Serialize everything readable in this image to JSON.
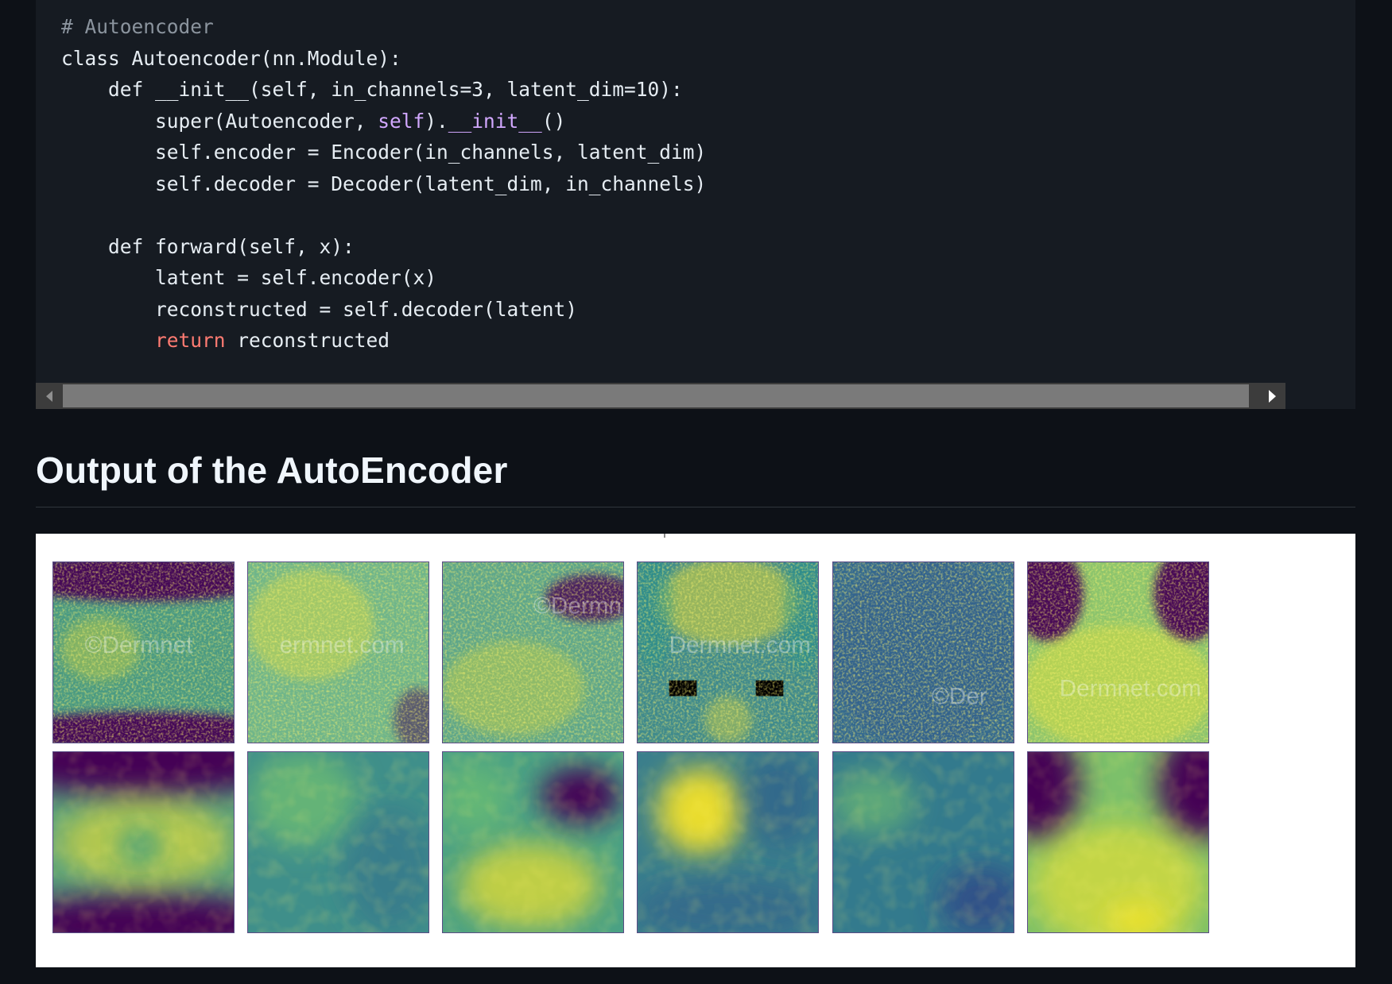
{
  "code": {
    "lines": [
      [
        {
          "t": "# Autoencoder",
          "c": "comment"
        }
      ],
      [
        {
          "t": "class Autoencoder(nn.Module):",
          "c": "plain"
        }
      ],
      [
        {
          "t": "    def __init__(self, in_channels=3, latent_dim=10):",
          "c": "plain"
        }
      ],
      [
        {
          "t": "        super(Autoencoder, ",
          "c": "plain"
        },
        {
          "t": "self",
          "c": "builtin"
        },
        {
          "t": ").",
          "c": "plain"
        },
        {
          "t": "__init__",
          "c": "dunder"
        },
        {
          "t": "()",
          "c": "plain"
        }
      ],
      [
        {
          "t": "        self.encoder = Encoder(in_channels, latent_dim)",
          "c": "plain"
        }
      ],
      [
        {
          "t": "        self.decoder = Decoder(latent_dim, in_channels)",
          "c": "plain"
        }
      ],
      [
        {
          "t": "",
          "c": "plain"
        }
      ],
      [
        {
          "t": "    def forward(self, x):",
          "c": "plain"
        }
      ],
      [
        {
          "t": "        latent = self.encoder(x)",
          "c": "plain"
        }
      ],
      [
        {
          "t": "        reconstructed = self.decoder(latent)",
          "c": "plain"
        }
      ],
      [
        {
          "t": "        ",
          "c": "plain"
        },
        {
          "t": "return",
          "c": "keyword"
        },
        {
          "t": " reconstructed",
          "c": "plain"
        }
      ]
    ]
  },
  "section": {
    "title": "Output of the AutoEncoder"
  },
  "figure": {
    "rows": [
      {
        "name": "originals",
        "tiles": [
          {
            "id": "orig-1",
            "watermark": "©Dermnet",
            "base": "#4a9a82"
          },
          {
            "id": "orig-2",
            "watermark": "ermnet.com",
            "base": "#6fb58a"
          },
          {
            "id": "orig-3",
            "watermark": "©Dermn",
            "base": "#5ea68a"
          },
          {
            "id": "orig-4",
            "watermark": "Dermnet.com",
            "base": "#3f8a8c"
          },
          {
            "id": "orig-5",
            "watermark": "©Der",
            "base": "#356a8f"
          },
          {
            "id": "orig-6",
            "watermark": "Dermnet.com",
            "base": "#8cc46d"
          }
        ]
      },
      {
        "name": "reconstructions",
        "tiles": [
          {
            "id": "recon-1",
            "base": "#56a07e"
          },
          {
            "id": "recon-2",
            "base": "#3f8f8a"
          },
          {
            "id": "recon-3",
            "base": "#4aa184"
          },
          {
            "id": "recon-4",
            "base": "#3a7e8c"
          },
          {
            "id": "recon-5",
            "base": "#337a8d"
          },
          {
            "id": "recon-6",
            "base": "#7cc06a"
          }
        ]
      }
    ]
  },
  "colors": {
    "page_bg": "#0d1117",
    "code_bg": "#161b22",
    "keyword": "#ff7b72",
    "builtin": "#d2a8ff",
    "comment": "#8b949e",
    "viridis_dark": "#440154",
    "viridis_mid": "#21918c",
    "viridis_bright": "#fde725"
  }
}
